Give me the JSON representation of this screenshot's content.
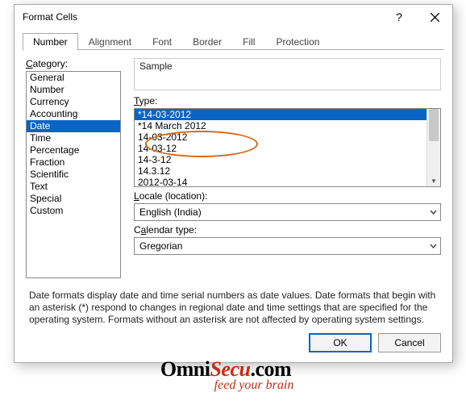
{
  "title": "Format Cells",
  "tabs": [
    "Number",
    "Alignment",
    "Font",
    "Border",
    "Fill",
    "Protection"
  ],
  "activeTab": "Number",
  "categoryLabel": "Category:",
  "categories": [
    "General",
    "Number",
    "Currency",
    "Accounting",
    "Date",
    "Time",
    "Percentage",
    "Fraction",
    "Scientific",
    "Text",
    "Special",
    "Custom"
  ],
  "selectedCategory": "Date",
  "sampleLabel": "Sample",
  "typeLabel": "Type:",
  "types": [
    "*14-03-2012",
    "*14 March 2012",
    "14-03-2012",
    "14-03-12",
    "14-3-12",
    "14.3.12",
    "2012-03-14"
  ],
  "selectedType": "*14-03-2012",
  "localeLabel": "Locale (location):",
  "localeValue": "English (India)",
  "calendarLabel": "Calendar type:",
  "calendarValue": "Gregorian",
  "description": "Date formats display date and time serial numbers as date values.  Date formats that begin with an asterisk (*) respond to changes in regional date and time settings that are specified for the operating system. Formats without an asterisk are not affected by operating system settings.",
  "okLabel": "OK",
  "cancelLabel": "Cancel",
  "watermark": {
    "part1": "Omni",
    "part2": "Secu",
    "part3": ".com",
    "tagline": "feed your brain"
  }
}
